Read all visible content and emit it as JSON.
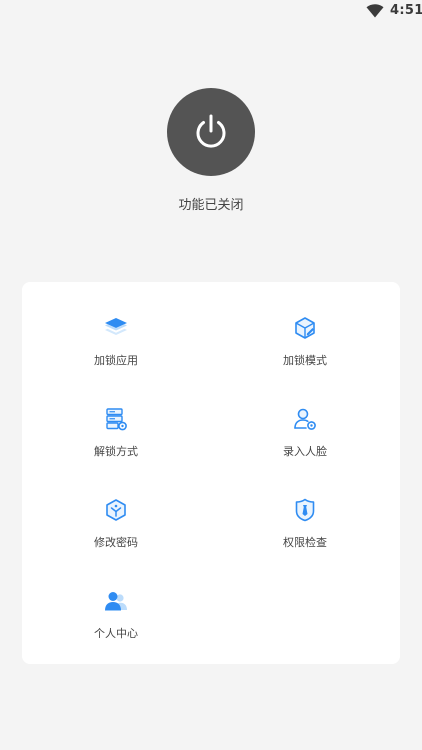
{
  "status_bar": {
    "time": "4:51",
    "icon": "wifi-icon"
  },
  "power": {
    "icon": "power-icon",
    "status": "功能已关闭",
    "button_color": "#545454"
  },
  "accent_color": "#2f8cf2",
  "menu": {
    "items": [
      {
        "label": "加锁应用",
        "icon": "layers-icon"
      },
      {
        "label": "加锁模式",
        "icon": "cube-edit-icon"
      },
      {
        "label": "解锁方式",
        "icon": "server-settings-icon"
      },
      {
        "label": "录入人脸",
        "icon": "user-settings-icon"
      },
      {
        "label": "修改密码",
        "icon": "package-icon"
      },
      {
        "label": "权限检查",
        "icon": "shield-check-icon"
      },
      {
        "label": "个人中心",
        "icon": "users-icon"
      }
    ]
  }
}
